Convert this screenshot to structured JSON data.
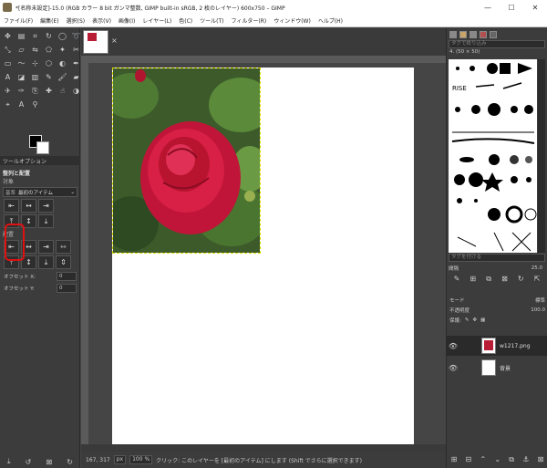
{
  "window": {
    "title": "*[名称未設定]-15.0 (RGB カラー 8 bit ガンマ整数, GIMP built-in sRGB, 2 枚のレイヤー) 600x750 – GIMP"
  },
  "menu": [
    "ファイル(F)",
    "編集(E)",
    "選択(S)",
    "表示(V)",
    "画像(I)",
    "レイヤー(L)",
    "色(C)",
    "ツール(T)",
    "フィルター(R)",
    "ウィンドウ(W)",
    "ヘルプ(H)"
  ],
  "toolbox": {
    "tools": [
      "move",
      "align",
      "crop",
      "rotate",
      "scale",
      "shear",
      "flip",
      "perspective",
      "unified-transform",
      "warp",
      "handle-transform",
      "cage",
      "rect-select",
      "ellipse-select",
      "free-select",
      "scissors",
      "fuzzy-select",
      "by-color-select",
      "paths",
      "color-picker",
      "zoom",
      "measure",
      "text",
      "bucket-fill",
      "gradient",
      "pencil",
      "paintbrush",
      "eraser",
      "airbrush",
      "ink",
      "mypaint",
      "clone",
      "heal",
      "smudge",
      "dodge-burn",
      "foreground-select"
    ],
    "tool_options_tab": "ツールオプション",
    "section_title": "整列と配置",
    "target_label": "対象",
    "relative_combo_label": "基準",
    "relative_combo_value": "最初のアイテム",
    "distribute_label": "配置",
    "offset_x_label": "オフセット X:",
    "offset_x_value": "0",
    "offset_y_label": "オフセット Y:",
    "offset_y_value": "0",
    "align_buttons": [
      "⇤",
      "↔",
      "⇥",
      "⤒",
      "↕",
      "⤓"
    ],
    "distribute_buttons": [
      "⇤",
      "↔",
      "⇥",
      "⇿",
      "⤒",
      "↕",
      "⤓",
      "⇕"
    ]
  },
  "image_tab": {
    "close": "×"
  },
  "status": {
    "coords": "167, 317",
    "unit": "px",
    "zoom": "100 %",
    "message": "クリック: このレイヤーを [最初のアイテム] にします (Shift でさらに選択できます)"
  },
  "brushes": {
    "filter_placeholder": "タグで絞り込み",
    "info": "4. (50 × 50)",
    "tag_placeholder": "タグを付ける",
    "spacing_label": "間隔",
    "spacing_value": "25.0"
  },
  "layers_panel": {
    "mode_label": "モード",
    "mode_value": "標準",
    "opacity_label": "不透明度",
    "opacity_value": "100.0",
    "lock_label": "保護:",
    "layers": [
      {
        "name": "w1217.png",
        "selected": true
      },
      {
        "name": "背景",
        "selected": false
      }
    ]
  },
  "colors": {
    "fg": "#000000",
    "bg": "#ffffff",
    "highlight": "#e01010"
  }
}
